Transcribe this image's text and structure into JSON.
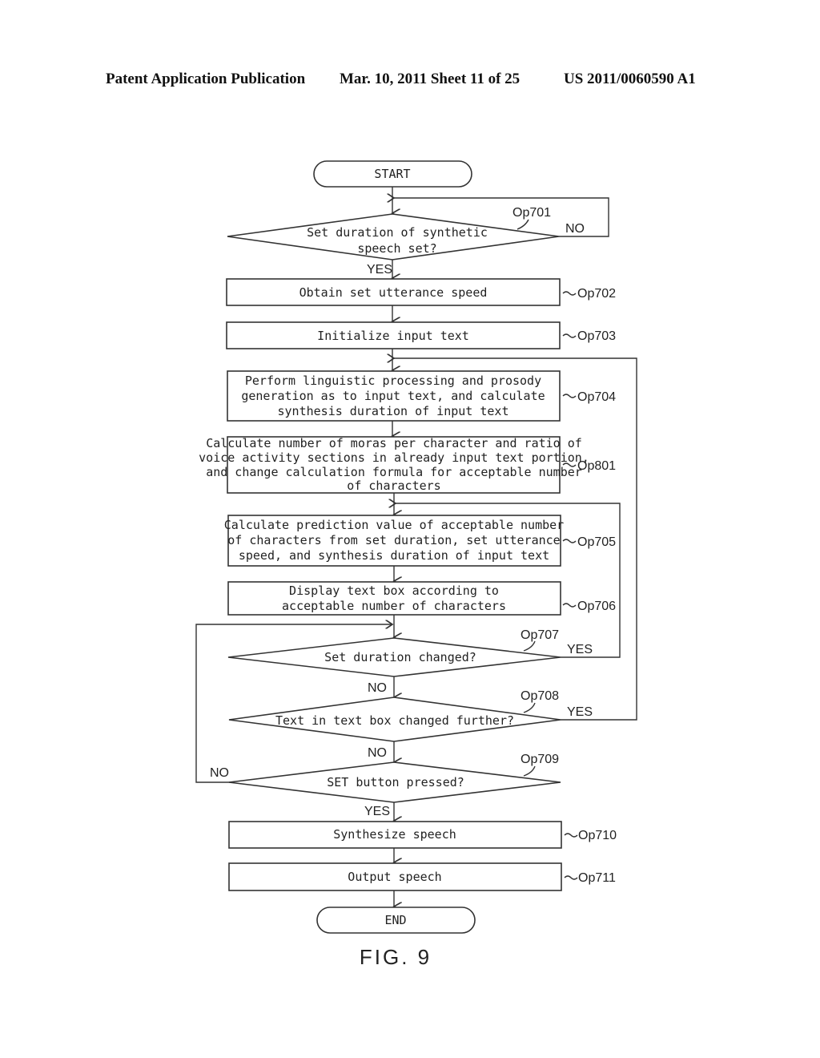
{
  "header": {
    "publication": "Patent Application Publication",
    "date_sheet": "Mar. 10, 2011  Sheet 11 of 25",
    "number": "US 2011/0060590 A1"
  },
  "figure_label": "FIG. 9",
  "flowchart": {
    "start": "START",
    "end": "END",
    "steps": {
      "op701": {
        "ref": "Op701",
        "lines": [
          "Set duration of synthetic",
          "speech set?"
        ],
        "yes": "YES",
        "no": "NO"
      },
      "op702": {
        "ref": "Op702",
        "lines": [
          "Obtain set utterance speed"
        ]
      },
      "op703": {
        "ref": "Op703",
        "lines": [
          "Initialize input text"
        ]
      },
      "op704": {
        "ref": "Op704",
        "lines": [
          "Perform linguistic processing and prosody",
          "generation as to input text, and calculate",
          "synthesis duration of input text"
        ]
      },
      "op801": {
        "ref": "Op801",
        "lines": [
          "Calculate number of moras per character and ratio of",
          "voice activity sections in already input text portion,",
          "and change calculation formula for acceptable number",
          "of characters"
        ]
      },
      "op705": {
        "ref": "Op705",
        "lines": [
          "Calculate prediction value of acceptable number",
          "of characters from set duration, set utterance",
          "speed, and synthesis duration of input text"
        ]
      },
      "op706": {
        "ref": "Op706",
        "lines": [
          "Display text box according to",
          "acceptable number of characters"
        ]
      },
      "op707": {
        "ref": "Op707",
        "lines": [
          "Set duration changed?"
        ],
        "yes": "YES",
        "no": "NO"
      },
      "op708": {
        "ref": "Op708",
        "lines": [
          "Text in text box changed further?"
        ],
        "yes": "YES",
        "no": "NO"
      },
      "op709": {
        "ref": "Op709",
        "lines": [
          "SET button pressed?"
        ],
        "yes": "YES",
        "no": "NO"
      },
      "op710": {
        "ref": "Op710",
        "lines": [
          "Synthesize speech"
        ]
      },
      "op711": {
        "ref": "Op711",
        "lines": [
          "Output speech"
        ]
      }
    }
  }
}
